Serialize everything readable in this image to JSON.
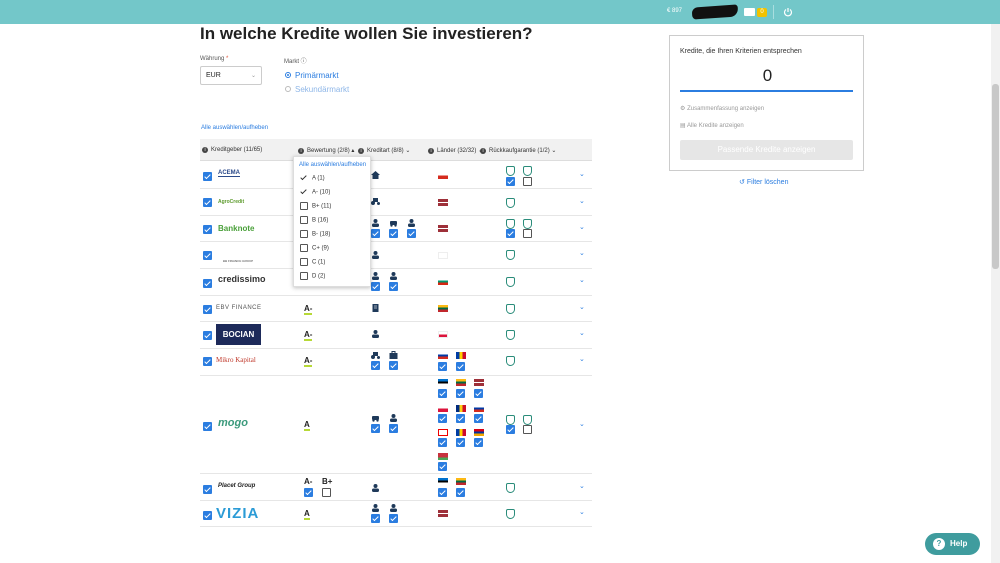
{
  "header": {
    "balance": "€ 897",
    "wallet_badge": "0"
  },
  "page": {
    "title": "In welche Kredite wollen Sie investieren?"
  },
  "filters": {
    "currency_label": "Währung",
    "currency_value": "EUR",
    "market_label": "Markt",
    "market_options": [
      "Primärmarkt",
      "Sekundärmarkt"
    ],
    "select_all": "Alle auswählen/aufheben"
  },
  "table": {
    "headers": [
      "Kreditgeber (11/65)",
      "Bewertung (2/8)",
      "Kreditart (8/8)",
      "Länder (32/32)",
      "Rückkaufgarantie (1/2)"
    ],
    "rows": [
      {
        "lender": "ACEMA",
        "ratings": []
      },
      {
        "lender": "AgroCredit",
        "ratings": []
      },
      {
        "lender": "Banknote",
        "ratings": []
      },
      {
        "lender": "BB FINANCE GROUP",
        "ratings": []
      },
      {
        "lender": "credissimo",
        "ratings": []
      },
      {
        "lender": "EBV FINANCE",
        "ratings": [
          "A-"
        ]
      },
      {
        "lender": "BOCIAN",
        "ratings": [
          "A-"
        ]
      },
      {
        "lender": "Mikro Kapital",
        "ratings": [
          "A-"
        ]
      },
      {
        "lender": "mogo",
        "ratings": [
          "A"
        ]
      },
      {
        "lender": "Placet Group",
        "ratings": [
          "A-",
          "B+"
        ]
      },
      {
        "lender": "VIZIA",
        "ratings": [
          "A"
        ]
      }
    ]
  },
  "rating_dropdown": {
    "select_all": "Alle auswählen/aufheben",
    "items": [
      "A (1)",
      "A- (10)",
      "B+ (11)",
      "B (16)",
      "B- (18)",
      "C+ (9)",
      "C (1)",
      "D (2)"
    ]
  },
  "side_panel": {
    "title": "Kredite, die Ihren Kriterien entsprechen",
    "count": "0",
    "summary_link": "Zusammenfassung anzeigen",
    "all_loans_link": "Alle Kredite anzeigen",
    "button": "Passende Kredite anzeigen",
    "reset": "Filter löschen"
  },
  "help": "Help"
}
